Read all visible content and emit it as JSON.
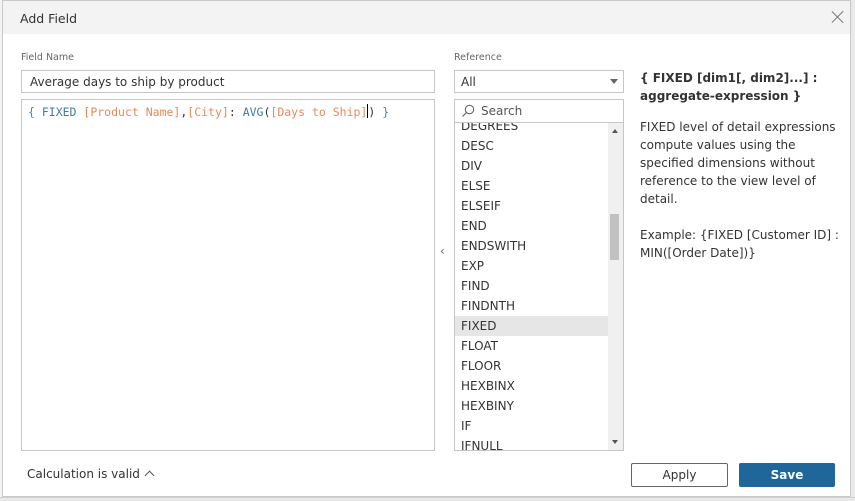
{
  "dialog": {
    "title": "Add Field",
    "close_icon": "close-icon"
  },
  "field_name": {
    "label": "Field Name",
    "value": "Average days to ship by product"
  },
  "editor": {
    "tokens": [
      {
        "text": "{ ",
        "type": "brace"
      },
      {
        "text": "FIXED ",
        "type": "kw"
      },
      {
        "text": "[Product Name]",
        "type": "field"
      },
      {
        "text": ",",
        "type": "punct"
      },
      {
        "text": "[City]",
        "type": "field"
      },
      {
        "text": ": ",
        "type": "punct"
      },
      {
        "text": "AVG",
        "type": "fn"
      },
      {
        "text": "(",
        "type": "punct"
      },
      {
        "text": "[Days to Ship]",
        "type": "field"
      },
      {
        "text": "|",
        "type": "caret"
      },
      {
        "text": ")",
        "type": "punct"
      },
      {
        "text": " }",
        "type": "brace"
      }
    ],
    "colors": {
      "keyword": "#3d7ab0",
      "field": "#e8895a",
      "punct": "#333333"
    }
  },
  "reference": {
    "label": "Reference",
    "selected": "All",
    "search_placeholder": "Search",
    "items": [
      "DEGREES",
      "DESC",
      "DIV",
      "ELSE",
      "ELSEIF",
      "END",
      "ENDSWITH",
      "EXP",
      "FIND",
      "FINDNTH",
      "FIXED",
      "FLOAT",
      "FLOOR",
      "HEXBINX",
      "HEXBINY",
      "IF",
      "IFNULL"
    ],
    "selected_item": "FIXED"
  },
  "help": {
    "signature": "{ FIXED [dim1[, dim2]...] : aggregate-expression }",
    "description": "FIXED level of detail expressions compute values using the specified dimensions without reference to the view level of detail.",
    "example": "Example: {FIXED [Customer ID] : MIN([Order Date])}"
  },
  "footer": {
    "status": "Calculation is valid",
    "apply_label": "Apply",
    "save_label": "Save",
    "save_color": "#1f679b"
  }
}
